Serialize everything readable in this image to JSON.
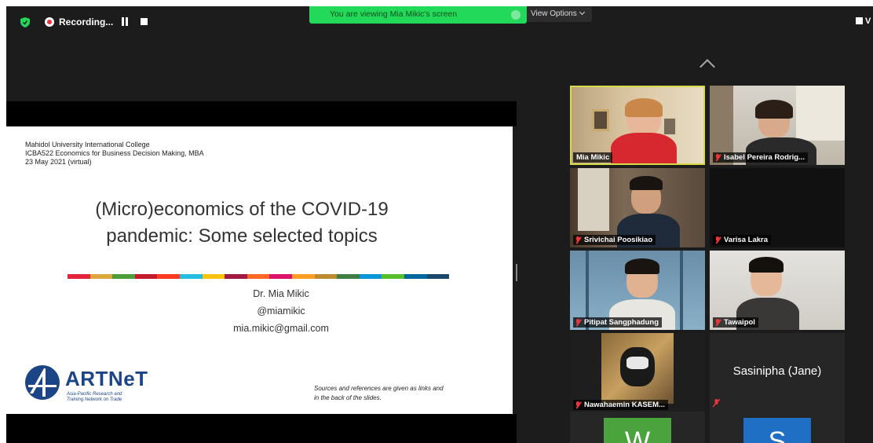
{
  "topbar": {
    "recording_label": "Recording...",
    "viewing_banner": "You are viewing Mia Mikic's screen",
    "view_options_label": "View Options",
    "view_right_label": "V"
  },
  "slide": {
    "meta_lines": [
      "Mahidol University International College",
      "ICBA522 Economics for Business Decision Making, MBA",
      "23 May 2021 (virtual)"
    ],
    "title_line1": "(Micro)economics of the COVID-19",
    "title_line2": "pandemic: Some selected topics",
    "author_name": "Dr. Mia Mikic",
    "author_handle": "@miamikic",
    "author_email": "mia.mikic@gmail.com",
    "logo_name": "ARTNeT",
    "logo_sub1": "Asia-Pacific Research and",
    "logo_sub2": "Training Network on Trade",
    "sources_line1": "Sources and references are given as links and",
    "sources_line2": "in the back of the slides.",
    "colorbar_colors": [
      "#e5243b",
      "#dda63a",
      "#4c9f38",
      "#c5192d",
      "#ff3a21",
      "#26bde2",
      "#fcc30b",
      "#a21942",
      "#fd6925",
      "#dd1367",
      "#fd9d24",
      "#bf8b2e",
      "#3f7e44",
      "#0a97d9",
      "#56c02b",
      "#00689d",
      "#19486a"
    ]
  },
  "participants": [
    {
      "name": "Mia Mikic",
      "muted": false,
      "video": true,
      "active": true
    },
    {
      "name": "Isabel Pereira Rodrig...",
      "muted": true,
      "video": true
    },
    {
      "name": "Srivichai Poosikiao",
      "muted": true,
      "video": true
    },
    {
      "name": "Varisa Lakra",
      "muted": true,
      "video": false
    },
    {
      "name": "Pitipat Sangphadung",
      "muted": true,
      "video": true
    },
    {
      "name": "Tawaipol",
      "muted": true,
      "video": true
    },
    {
      "name": "Nawahaemin KASEM...",
      "muted": true,
      "video": true
    },
    {
      "name": "Sasinipha (Jane)",
      "muted": true,
      "video": false
    },
    {
      "avatar_letter": "W",
      "avatar_color": "#4aa33c"
    },
    {
      "avatar_letter": "S",
      "avatar_color": "#1f6fc4"
    }
  ],
  "colors": {
    "active_speaker": "#d6db4a",
    "banner": "#23d959",
    "muted": "#e8363b"
  },
  "icons": [
    "shield-icon",
    "record-icon",
    "pause-icon",
    "stop-icon",
    "chevron-down-icon",
    "chevron-up-icon",
    "mic-muted-icon",
    "artnet-logo"
  ]
}
